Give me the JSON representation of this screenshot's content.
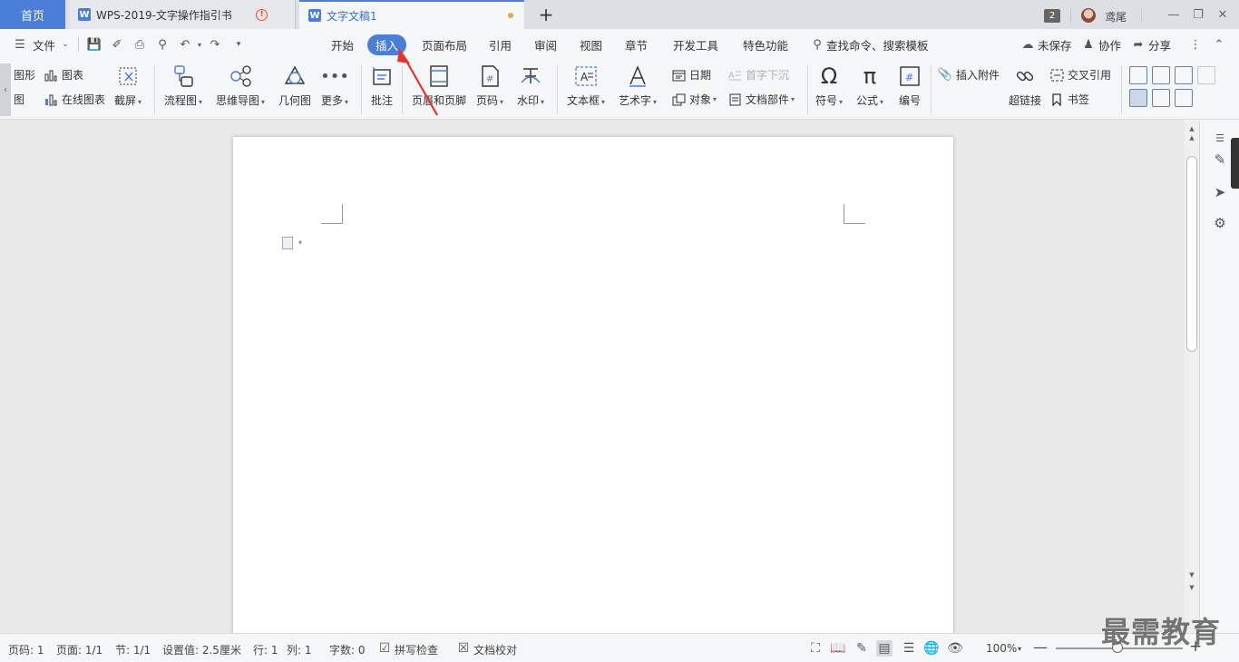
{
  "tabs": {
    "home": "首页",
    "doc1": "WPS-2019-文字操作指引书",
    "doc2": "文字文稿1"
  },
  "titlebar": {
    "badge": "2",
    "username": "鸢尾"
  },
  "menu": {
    "file": "文件",
    "items": [
      "开始",
      "插入",
      "页面布局",
      "引用",
      "审阅",
      "视图",
      "章节",
      "开发工具",
      "特色功能"
    ],
    "search": "查找命令、搜索模板",
    "unsaved": "未保存",
    "collab": "协作",
    "share": "分享"
  },
  "ribbon": {
    "shapes_partial": "图形",
    "pic_partial": "图",
    "chart": "图表",
    "online_chart": "在线图表",
    "screenshot": "截屏",
    "flowchart": "流程图",
    "mindmap": "思维导图",
    "geometry": "几何图",
    "more": "更多",
    "comment": "批注",
    "header_footer": "页眉和页脚",
    "page_number": "页码",
    "watermark": "水印",
    "textbox": "文本框",
    "wordart": "艺术字",
    "date": "日期",
    "dropcap": "首字下沉",
    "object": "对象",
    "doc_parts": "文档部件",
    "symbol": "符号",
    "formula": "公式",
    "numbering": "编号",
    "attachment": "插入附件",
    "hyperlink": "超链接",
    "cross_ref": "交叉引用",
    "bookmark": "书签"
  },
  "status": {
    "page": "页码: 1",
    "pages": "页面: 1/1",
    "section": "节: 1/1",
    "setting": "设置值: 2.5厘米",
    "row": "行: 1",
    "col": "列: 1",
    "words": "字数: 0",
    "spellcheck": "拼写检查",
    "proofread": "文档校对",
    "zoom": "100%"
  },
  "watermark_text": "最需教育",
  "colors": {
    "accent": "#4a7ed9",
    "arrow": "#e8332a"
  }
}
